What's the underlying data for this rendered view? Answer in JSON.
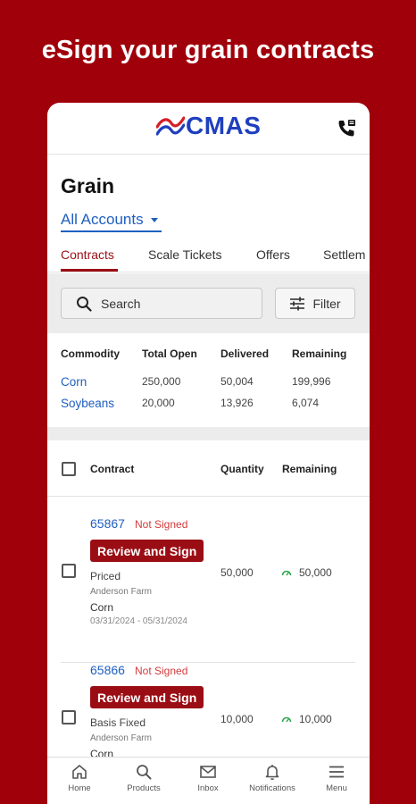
{
  "headline": "eSign your grain contracts",
  "app": {
    "logo_text": "CMAS",
    "page_title": "Grain",
    "account_selector": "All Accounts",
    "tabs": [
      {
        "label": "Contracts",
        "active": true
      },
      {
        "label": "Scale Tickets",
        "active": false
      },
      {
        "label": "Offers",
        "active": false
      },
      {
        "label": "Settlem",
        "active": false
      }
    ],
    "search": {
      "label": "Search"
    },
    "filter": {
      "label": "Filter"
    },
    "summary": {
      "headers": [
        "Commodity",
        "Total Open",
        "Delivered",
        "Remaining"
      ],
      "rows": [
        {
          "commodity": "Corn",
          "total_open": "250,000",
          "delivered": "50,004",
          "remaining": "199,996"
        },
        {
          "commodity": "Soybeans",
          "total_open": "20,000",
          "delivered": "13,926",
          "remaining": "6,074"
        }
      ]
    },
    "contracts": {
      "headers": {
        "contract": "Contract",
        "quantity": "Quantity",
        "remaining": "Remaining"
      },
      "items": [
        {
          "number": "65867",
          "status": "Not Signed",
          "action": "Review and Sign",
          "type": "Priced",
          "farm": "Anderson Farm",
          "commodity": "Corn",
          "dates": "03/31/2024 - 05/31/2024",
          "quantity": "50,000",
          "remaining": "50,000"
        },
        {
          "number": "65866",
          "status": "Not Signed",
          "action": "Review and Sign",
          "type": "Basis Fixed",
          "farm": "Anderson Farm",
          "commodity": "Corn",
          "dates": "",
          "quantity": "10,000",
          "remaining": "10,000"
        }
      ]
    },
    "bottom_nav": [
      {
        "label": "Home",
        "icon": "home-icon"
      },
      {
        "label": "Products",
        "icon": "search-icon"
      },
      {
        "label": "Inbox",
        "icon": "mail-icon"
      },
      {
        "label": "Notifications",
        "icon": "bell-icon"
      },
      {
        "label": "Menu",
        "icon": "menu-icon"
      }
    ]
  },
  "colors": {
    "brand_red": "#a0000a",
    "button_red": "#9b0d14",
    "link_blue": "#1f5fbf",
    "status_red": "#d23b3b",
    "logo_blue": "#1f3fbf"
  }
}
